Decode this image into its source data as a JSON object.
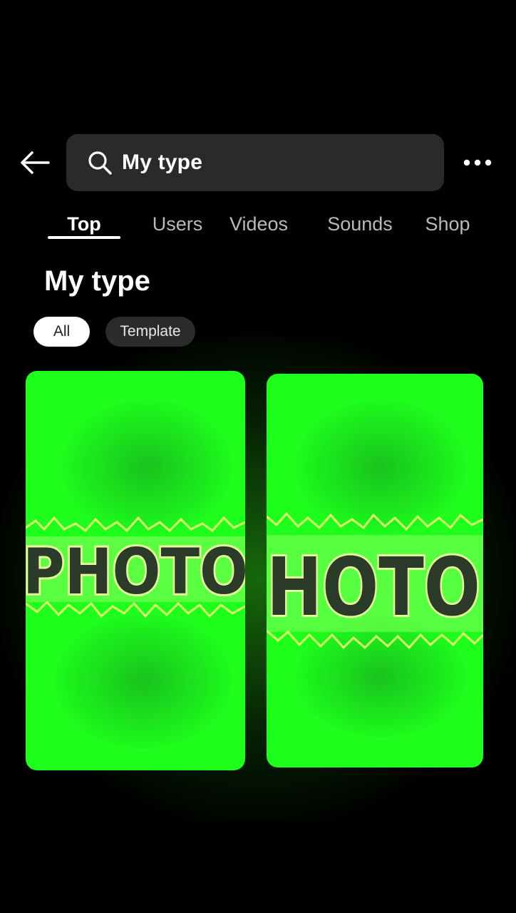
{
  "header": {
    "back_icon": "arrow-left-icon",
    "search": {
      "icon": "search-icon",
      "query": "My type"
    },
    "more_icon": "more-horizontal-icon"
  },
  "tabs": [
    {
      "label": "Top",
      "active": true
    },
    {
      "label": "Users",
      "active": false
    },
    {
      "label": "Videos",
      "active": false
    },
    {
      "label": "Sounds",
      "active": false
    },
    {
      "label": "Shop",
      "active": false
    }
  ],
  "results": {
    "title": "My type",
    "filters": [
      {
        "label": "All",
        "selected": true
      },
      {
        "label": "Template",
        "selected": false
      }
    ],
    "cards": [
      {
        "overlay_text": "PHOTO"
      },
      {
        "overlay_text": "HOTO"
      }
    ]
  },
  "colors": {
    "background": "#000000",
    "search_bg": "#2a2a2a",
    "green_screen": "#1eff1c",
    "tab_inactive": "#b9b9b9"
  }
}
